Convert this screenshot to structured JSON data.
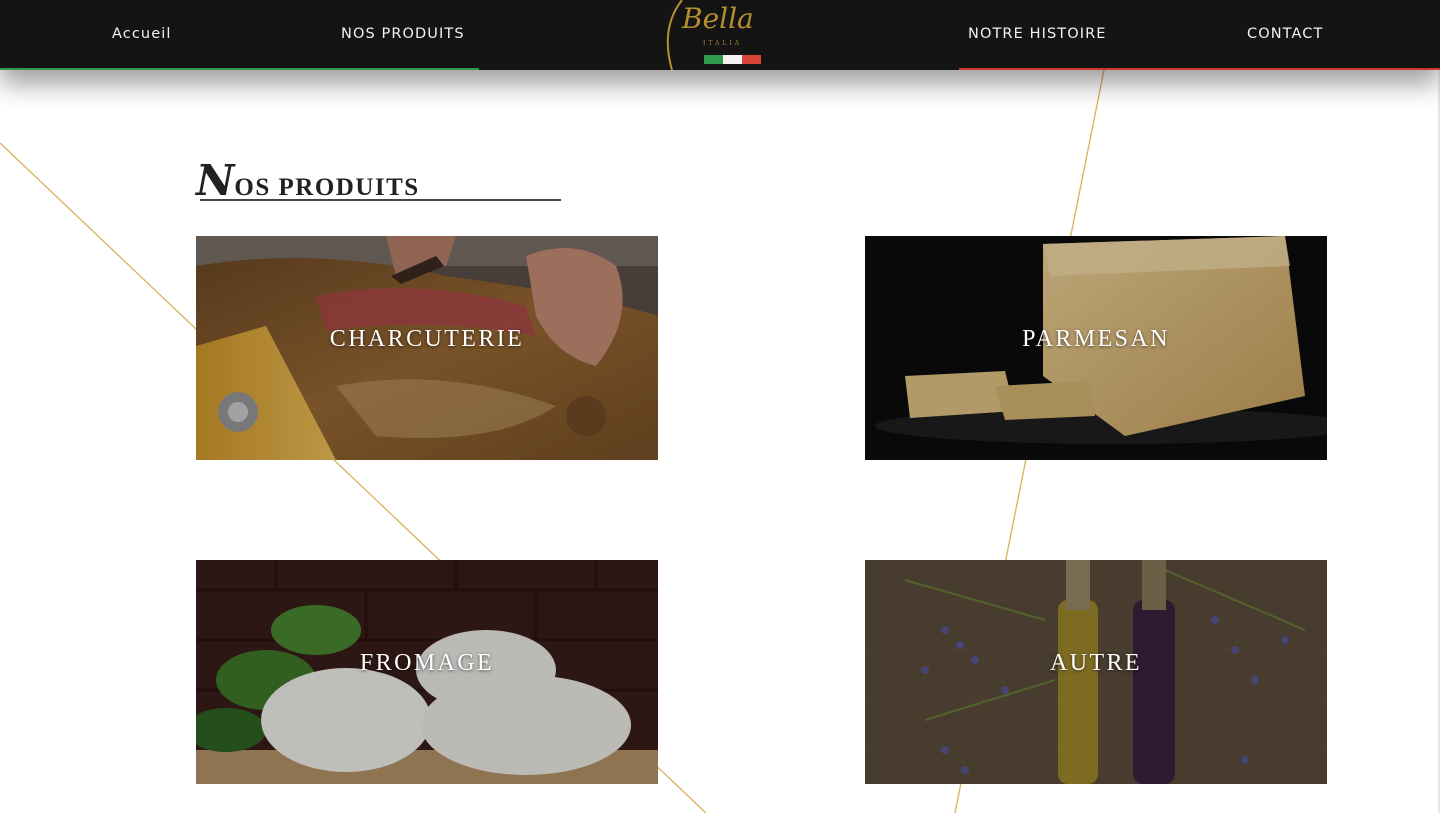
{
  "nav": {
    "home": "Accueil",
    "products": "NOS PRODUITS",
    "history": "NOTRE HISTOIRE",
    "contact": "CONTACT"
  },
  "logo": {
    "script": "Bella",
    "subtitle": "ITALIA",
    "flag_colors": [
      "#2e9a4a",
      "#f4f4f4",
      "#d8463a"
    ]
  },
  "section": {
    "title_initial": "N",
    "title_rest": "OS PRODUITS"
  },
  "products": [
    {
      "label": "CHARCUTERIE"
    },
    {
      "label": "PARMESAN"
    },
    {
      "label": "FROMAGE"
    },
    {
      "label": "AUTRE"
    }
  ],
  "colors": {
    "header": "#141414",
    "accent_gold": "#d8b25a",
    "stripe_green": "#2e9a4a",
    "stripe_red": "#c93a2c"
  }
}
